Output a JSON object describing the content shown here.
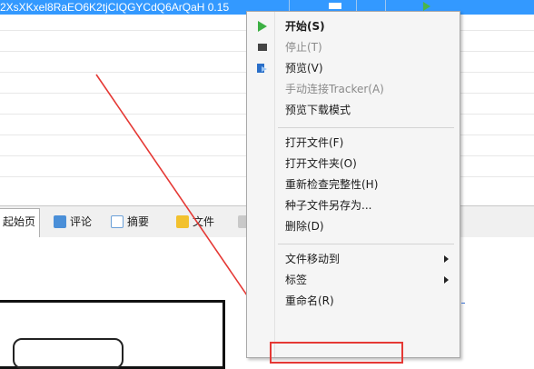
{
  "torrent_list": {
    "selected_name": "2XsXKxel8RaEO6K2tjCIQGYCdQ6ArQaH 0.15"
  },
  "tabs": [
    {
      "label": "起始页"
    },
    {
      "label": "评论"
    },
    {
      "label": "摘要"
    },
    {
      "label": "文件"
    }
  ],
  "context_menu": {
    "items": [
      {
        "label": "开始(S)",
        "icon": "play-icon"
      },
      {
        "label": "停止(T)",
        "icon": "stop-icon"
      },
      {
        "label": "预览(V)",
        "icon": "preview-icon"
      },
      {
        "label": "手动连接Tracker(A)"
      },
      {
        "label": "预览下载模式"
      },
      {
        "label": "打开文件(F)"
      },
      {
        "label": "打开文件夹(O)"
      },
      {
        "label": "重新检查完整性(H)"
      },
      {
        "label": "种子文件另存为..."
      },
      {
        "label": "删除(D)"
      },
      {
        "label": "文件移动到"
      },
      {
        "label": "标签"
      },
      {
        "label": "重命名(R)"
      }
    ]
  },
  "colors": {
    "selection": "#3399ff",
    "annotation_red": "#e53935"
  }
}
